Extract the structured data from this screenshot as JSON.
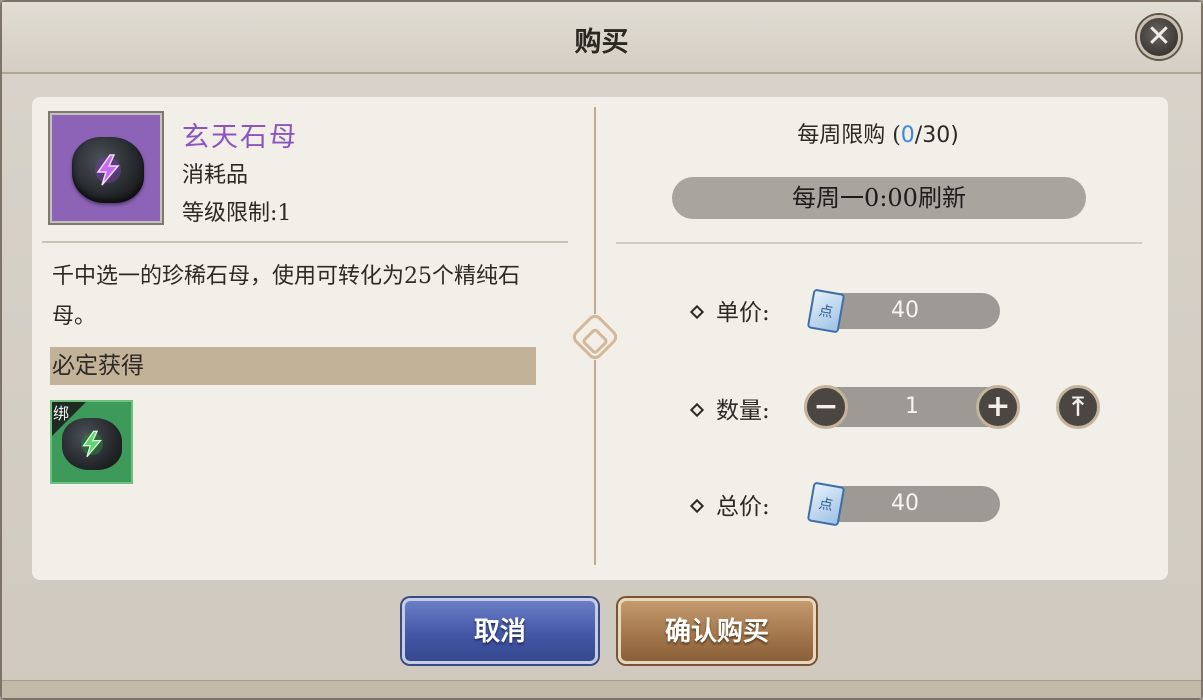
{
  "dialog": {
    "title": "购买",
    "close_icon": "close-icon"
  },
  "item": {
    "name": "玄天石母",
    "type": "消耗品",
    "level_limit": "等级限制:1",
    "description": "千中选一的珍稀石母，使用可转化为25个精纯石母。",
    "icon": "purple-lightning-gem-icon",
    "name_color": "#8a55c0"
  },
  "rewards": {
    "section_label": "必定获得",
    "items": [
      {
        "bind_label": "绑",
        "icon": "green-lightning-gem-icon"
      }
    ]
  },
  "purchase": {
    "weekly_limit_prefix": "每周限购 (",
    "weekly_limit_used": "0",
    "weekly_limit_suffix": "/30)",
    "refresh_text": "每周一0:00刷新",
    "unit_price_label": "单价:",
    "unit_price": "40",
    "quantity_label": "数量:",
    "quantity": "1",
    "total_price_label": "总价:",
    "total_price": "40",
    "currency_icon": "scroll-currency-icon",
    "currency_glyph": "点",
    "minus_glyph": "−",
    "plus_glyph": "+",
    "max_glyph": "⤒"
  },
  "buttons": {
    "cancel": "取消",
    "confirm": "确认购买"
  },
  "colors": {
    "accent_blue": "#3a87e0",
    "cancel_button": "#4357a6",
    "confirm_button": "#a5784d"
  }
}
